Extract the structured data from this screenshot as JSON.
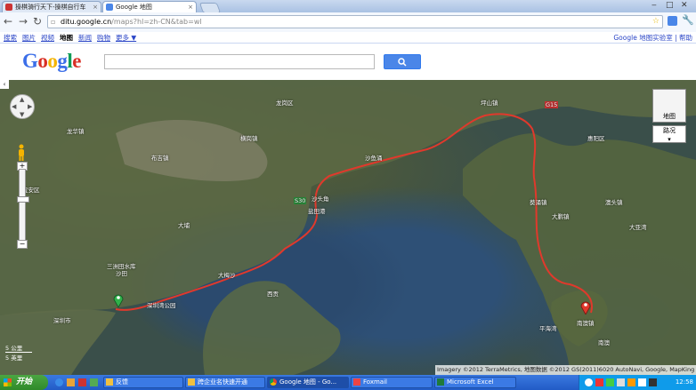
{
  "tabs": [
    {
      "label": "操棋骑行天下-操棋自行车"
    },
    {
      "label": "Google 地图"
    }
  ],
  "address": {
    "host": "ditu.google.cn",
    "path": "/maps?hl=zh-CN&tab=wl"
  },
  "gbar": {
    "links": [
      "搜索",
      "图片",
      "视频",
      "地图",
      "新闻",
      "购物",
      "更多 ▼"
    ],
    "right": "Google 地图实验室 | 帮助"
  },
  "logo": "Google",
  "search": {
    "value": "",
    "button_icon": "search-icon"
  },
  "map": {
    "type_button": "地图",
    "traffic_button": "路况",
    "scale": [
      "5 公里",
      "5 英里"
    ],
    "attribution": "Imagery ©2012 TerraMetrics, 地图数据 ©2012 GS(2011)6020 AutoNavi, Google, MapKing -",
    "labels": [
      {
        "text": "深圳市",
        "cls": "a"
      },
      {
        "text": "龙岗区",
        "cls": "b"
      },
      {
        "text": "横岗镇",
        "cls": "c"
      },
      {
        "text": "坪山镇",
        "cls": "d"
      },
      {
        "text": "葵涌镇",
        "cls": "e"
      },
      {
        "text": "大鹏镇",
        "cls": "f"
      },
      {
        "text": "南澳镇",
        "cls": "g"
      },
      {
        "text": "盐田港",
        "cls": "h"
      },
      {
        "text": "沙头角",
        "cls": "i"
      },
      {
        "text": "大亚湾",
        "cls": "j"
      },
      {
        "text": "惠阳区",
        "cls": "k"
      },
      {
        "text": "澳头镇",
        "cls": "l"
      },
      {
        "text": "沙鱼涌",
        "cls": "m"
      },
      {
        "text": "大梅沙",
        "cls": "n"
      },
      {
        "text": "西贡",
        "cls": "o"
      },
      {
        "text": "大埔",
        "cls": "p"
      },
      {
        "text": "沙田",
        "cls": "q"
      },
      {
        "text": "南澳",
        "cls": "r"
      },
      {
        "text": "平海湾",
        "cls": "s"
      },
      {
        "text": "布吉镇",
        "cls": "t"
      },
      {
        "text": "龙华镇",
        "cls": "u"
      },
      {
        "text": "宝安区",
        "cls": "v"
      },
      {
        "text": "三洲田水库",
        "cls": "w"
      },
      {
        "text": "深圳湾公园",
        "cls": "x"
      },
      {
        "text": "G15",
        "cls": "y"
      },
      {
        "text": "S30",
        "cls": "z"
      }
    ]
  },
  "taskbar": {
    "start": "开始",
    "tasks": [
      "反馈",
      "跨企业名快速开通",
      "Google 地图 - Go...",
      "Foxmail",
      "Microsoft Excel"
    ],
    "clock": "12:58"
  }
}
